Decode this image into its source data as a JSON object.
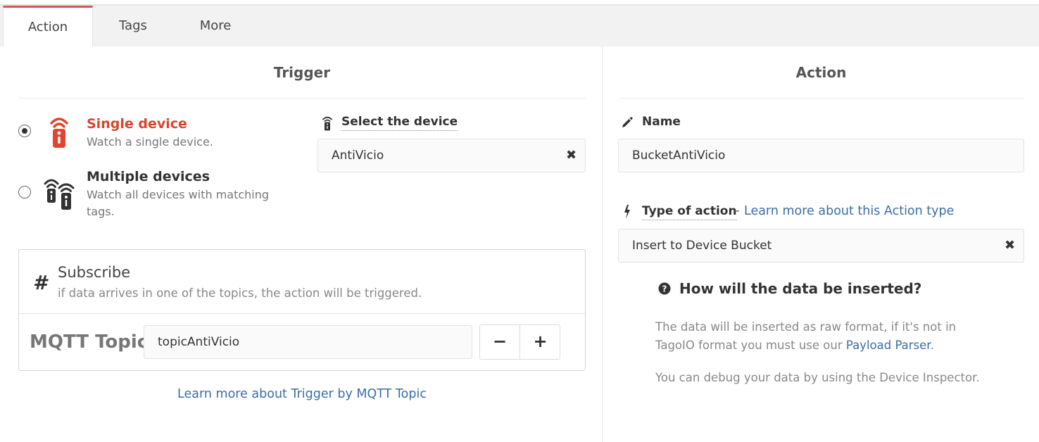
{
  "tabs": [
    {
      "label": "Action",
      "active": true
    },
    {
      "label": "Tags",
      "active": false
    },
    {
      "label": "More",
      "active": false
    }
  ],
  "trigger": {
    "title": "Trigger",
    "options": [
      {
        "title": "Single device",
        "desc": "Watch a single device.",
        "selected": true,
        "icon": "single-remote-icon"
      },
      {
        "title": "Multiple devices",
        "desc": "Watch all devices with matching tags.",
        "selected": false,
        "icon": "multiple-remote-icon"
      }
    ],
    "select_device_label": "Select the device",
    "device_value": "AntiVicio",
    "subscribe": {
      "title": "Subscribe",
      "desc": "if data arrives in one of the topics, the action will be triggered.",
      "topic_label": "MQTT Topic",
      "topic_value": "topicAntiVicio",
      "minus": "−",
      "plus": "+"
    },
    "learn_more": "Learn more about Trigger by MQTT Topic"
  },
  "action": {
    "title": "Action",
    "name_label": "Name",
    "name_value": "BucketAntiVicio",
    "type_label": "Type of action",
    "type_dash": "–",
    "type_learn_more": "Learn more about this Action type",
    "type_value": "Insert to Device Bucket",
    "help_title": "How will the data be inserted?",
    "help_p1_before": "The data will be inserted as raw format, if it's not in TagoIO format you must use our ",
    "help_p1_link": "Payload Parser",
    "help_p1_after": ".",
    "help_p2": "You can debug your data by using the Device Inspector."
  },
  "colors": {
    "accent": "#d9534f",
    "link": "#3a6ea5"
  }
}
